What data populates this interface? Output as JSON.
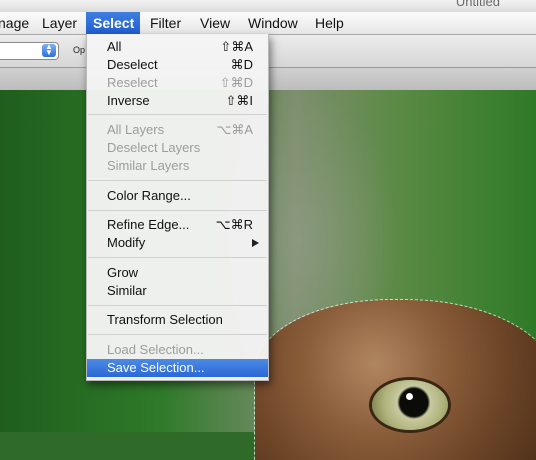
{
  "window": {
    "title": "Untitled"
  },
  "menubar": {
    "items": [
      {
        "label": "nage"
      },
      {
        "label": "Layer"
      },
      {
        "label": "Select",
        "active": true
      },
      {
        "label": "Filter"
      },
      {
        "label": "View"
      },
      {
        "label": "Window"
      },
      {
        "label": "Help"
      }
    ]
  },
  "options_bar": {
    "label": "Op"
  },
  "select_menu": {
    "items": [
      {
        "label": "All",
        "shortcut": "⇧⌘A",
        "enabled": true
      },
      {
        "label": "Deselect",
        "shortcut": "⌘D",
        "enabled": true
      },
      {
        "label": "Reselect",
        "shortcut": "⇧⌘D",
        "enabled": false
      },
      {
        "label": "Inverse",
        "shortcut": "⇧⌘I",
        "enabled": true
      },
      {
        "label": "All Layers",
        "shortcut": "⌥⌘A",
        "enabled": false
      },
      {
        "label": "Deselect Layers",
        "shortcut": "",
        "enabled": false
      },
      {
        "label": "Similar Layers",
        "shortcut": "",
        "enabled": false
      },
      {
        "label": "Color Range...",
        "shortcut": "",
        "enabled": true
      },
      {
        "label": "Refine Edge...",
        "shortcut": "⌥⌘R",
        "enabled": true
      },
      {
        "label": "Modify",
        "shortcut": "",
        "enabled": true,
        "submenu": true
      },
      {
        "label": "Grow",
        "shortcut": "",
        "enabled": true
      },
      {
        "label": "Similar",
        "shortcut": "",
        "enabled": true
      },
      {
        "label": "Transform Selection",
        "shortcut": "",
        "enabled": true
      },
      {
        "label": "Load Selection...",
        "shortcut": "",
        "enabled": false
      },
      {
        "label": "Save Selection...",
        "shortcut": "",
        "enabled": true,
        "highlighted": true
      }
    ]
  },
  "colors": {
    "menu_highlight": "#2a68d6",
    "disabled_text": "#9c9c9c",
    "background_green": "#2f7a2a"
  }
}
